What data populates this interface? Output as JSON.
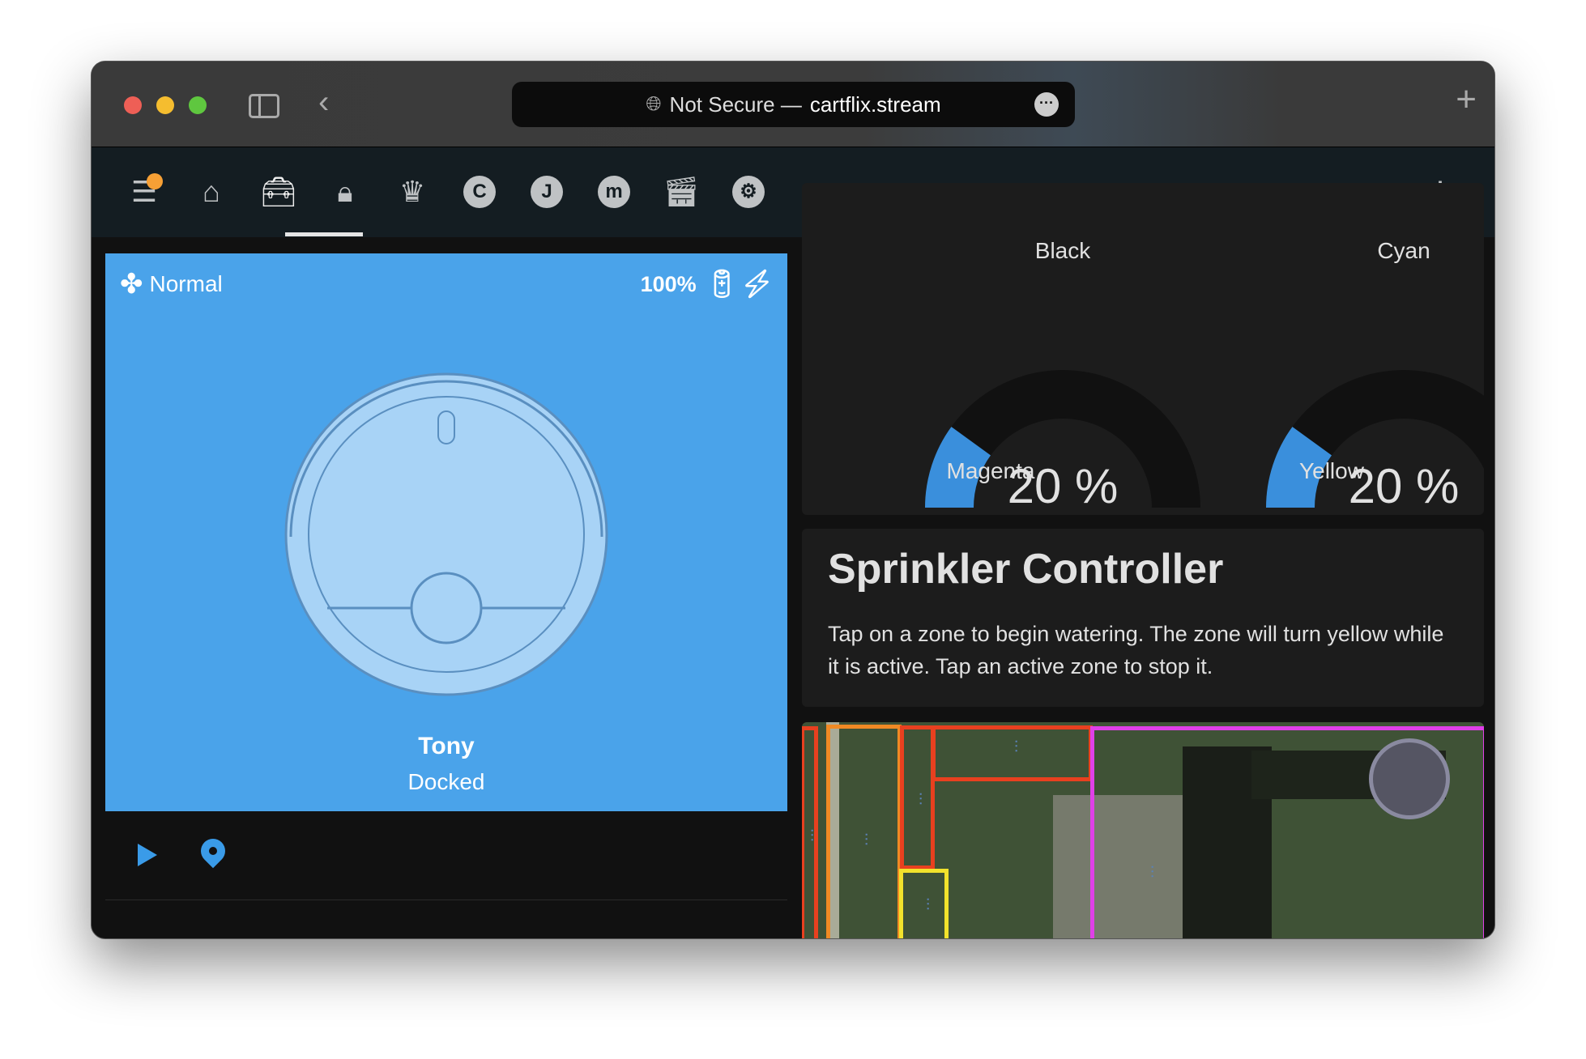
{
  "browser": {
    "url_prefix": "Not Secure —",
    "url_domain": "cartflix.stream"
  },
  "nav": {
    "items": [
      "menu",
      "home",
      "toolbox",
      "lock",
      "crown",
      "C",
      "J",
      "m",
      "clapperboard",
      "steam"
    ],
    "active": "toolbox",
    "badge_color": "#f7a035"
  },
  "vacuum": {
    "fan_mode": "Normal",
    "battery": "100%",
    "name": "Tony",
    "status": "Docked",
    "bg_color": "#4aa3ea"
  },
  "gauges": {
    "top_labels": [
      "Black",
      "Cyan"
    ],
    "items": [
      {
        "label": "Magenta",
        "value": 20,
        "display": "20 %"
      },
      {
        "label": "Yellow",
        "value": 20,
        "display": "20 %"
      }
    ],
    "accent": "#3a8fdc"
  },
  "sprinkler": {
    "title": "Sprinkler Controller",
    "description": "Tap on a zone to begin watering. The zone will turn yellow while it is active. Tap an active zone to stop it.",
    "zone_colors": [
      "#e8401f",
      "#f08a24",
      "#e8401f",
      "#e8401f",
      "#f2e22c",
      "#e040e8"
    ]
  }
}
